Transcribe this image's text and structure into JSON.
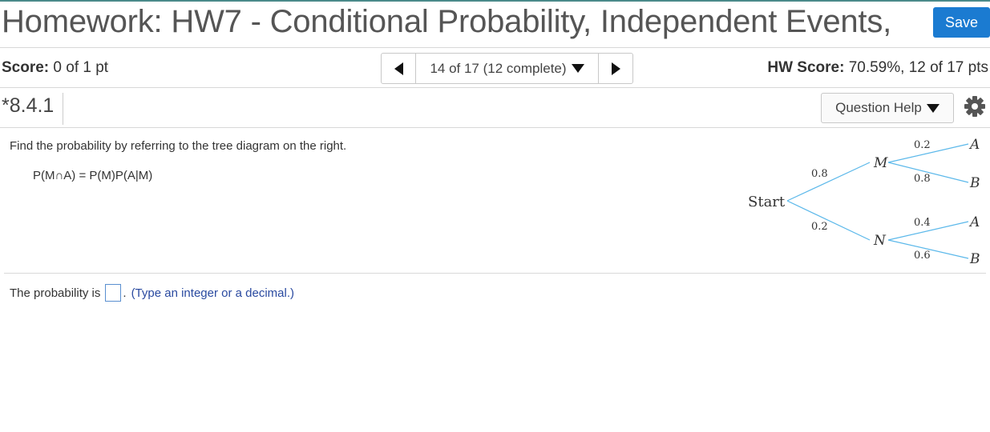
{
  "header": {
    "title": "Homework: HW7 - Conditional Probability, Independent Events,",
    "save_label": "Save"
  },
  "status": {
    "score_label": "Score:",
    "score_value": "0 of 1 pt",
    "nav_text": "14 of 17 (12 complete)",
    "hw_score_label": "HW Score:",
    "hw_score_value": "70.59%, 12 of 17 pts"
  },
  "question": {
    "number": "*8.4.1",
    "help_label": "Question Help",
    "prompt": "Find the probability by referring to the tree diagram on the right.",
    "formula": "P(M∩A) = P(M)P(A|M)"
  },
  "tree": {
    "root": "Start",
    "branches": [
      {
        "node": "M",
        "prob": "0.8",
        "children": [
          {
            "node": "A",
            "prob": "0.2"
          },
          {
            "node": "B",
            "prob": "0.8"
          }
        ]
      },
      {
        "node": "N",
        "prob": "0.2",
        "children": [
          {
            "node": "A",
            "prob": "0.4"
          },
          {
            "node": "B",
            "prob": "0.6"
          }
        ]
      }
    ],
    "line_color": "#5bb8ea"
  },
  "answer": {
    "prefix": "The probability is",
    "value": "",
    "suffix": ".",
    "hint": "(Type an integer or a decimal.)"
  }
}
